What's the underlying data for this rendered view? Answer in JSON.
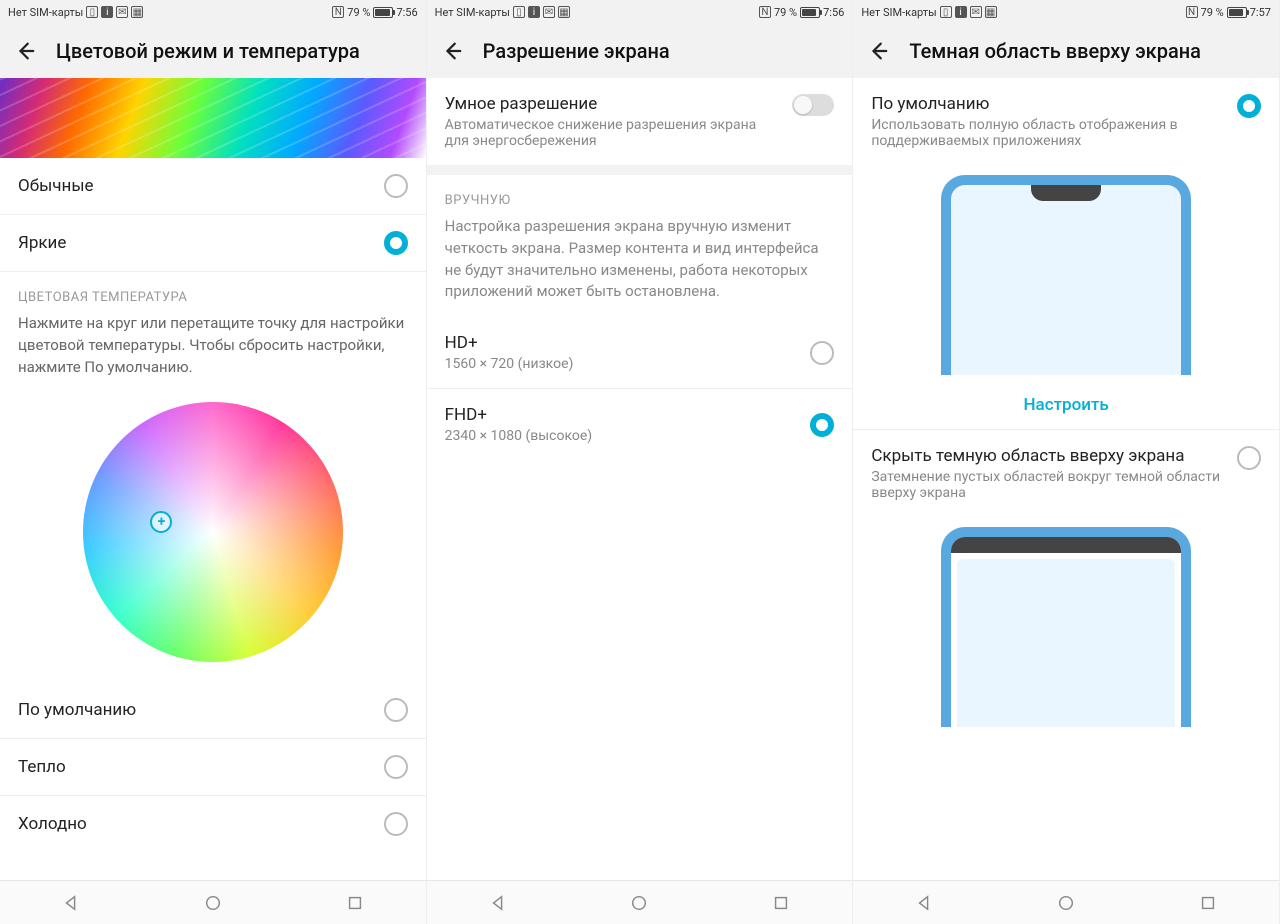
{
  "status": {
    "no_sim": "Нет SIM-карты",
    "battery_pct": "79 %",
    "time1": "7:56",
    "time2": "7:56",
    "time3": "7:57"
  },
  "screen1": {
    "title": "Цветовой режим и температура",
    "modes": {
      "normal": "Обычные",
      "vivid": "Яркие"
    },
    "temp_header": "ЦВЕТОВАЯ ТЕМПЕРАТУРА",
    "temp_desc": "Нажмите на круг или перетащите точку для настройки цветовой температуры. Чтобы сбросить настройки, нажмите По умолчанию.",
    "presets": {
      "default": "По умолчанию",
      "warm": "Тепло",
      "cold": "Холодно"
    }
  },
  "screen2": {
    "title": "Разрешение экрана",
    "smart": {
      "label": "Умное разрешение",
      "desc": "Автоматическое снижение разрешения экрана для энергосбережения"
    },
    "manual_header": "ВРУЧНУЮ",
    "manual_desc": "Настройка разрешения экрана вручную изменит четкость экрана. Размер контента и вид интерфейса не будут значительно изменены, работа некоторых приложений может быть остановлена.",
    "options": {
      "hd_label": "HD+",
      "hd_sub": "1560 × 720 (низкое)",
      "fhd_label": "FHD+",
      "fhd_sub": "2340 × 1080 (высокое)"
    }
  },
  "screen3": {
    "title": "Темная область вверху экрана",
    "default_label": "По умолчанию",
    "default_desc": "Использовать полную область отображения в поддерживаемых приложениях",
    "configure": "Настроить",
    "hide_label": "Скрыть темную область вверху экрана",
    "hide_desc": "Затемнение пустых областей вокруг темной области вверху экрана"
  }
}
